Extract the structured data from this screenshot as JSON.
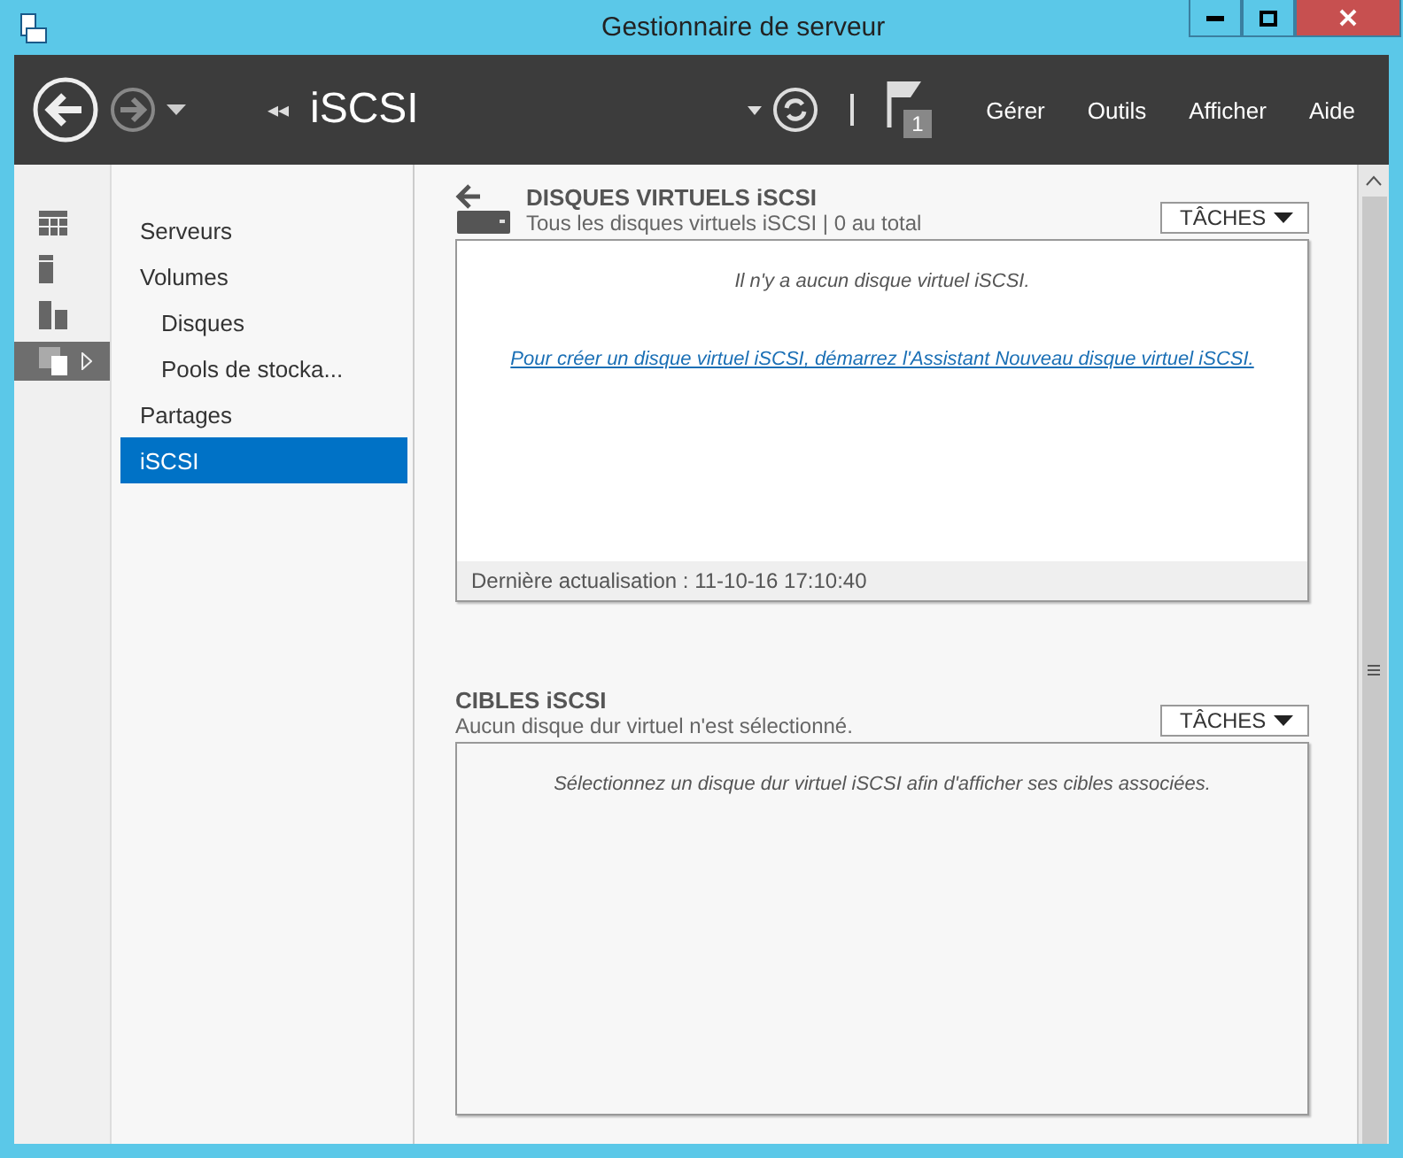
{
  "window": {
    "title": "Gestionnaire de serveur"
  },
  "toolbar": {
    "breadcrumb_arrows": "◂◂",
    "location": "iSCSI",
    "flag_count": "1",
    "menus": [
      "Gérer",
      "Outils",
      "Afficher",
      "Aide"
    ]
  },
  "rail": [
    {
      "kind": "dashboard",
      "selected": false
    },
    {
      "kind": "server",
      "selected": false
    },
    {
      "kind": "servers",
      "selected": false
    },
    {
      "kind": "files",
      "selected": true
    }
  ],
  "nav": [
    {
      "label": "Serveurs",
      "selected": false
    },
    {
      "label": "Volumes",
      "selected": false,
      "children": [
        {
          "label": "Disques",
          "selected": false
        },
        {
          "label": "Pools de stocka...",
          "selected": false
        }
      ]
    },
    {
      "label": "Partages",
      "selected": false
    },
    {
      "label": "iSCSI",
      "selected": true
    }
  ],
  "sections": [
    {
      "title": "DISQUES VIRTUELS iSCSI",
      "subtitle": "Tous les disques virtuels iSCSI | 0 au total",
      "tasks": "TÂCHES",
      "message": "Il n'y a aucun disque virtuel iSCSI.",
      "link": "Pour créer un disque virtuel iSCSI, démarrez l'Assistant Nouveau disque virtuel iSCSI.",
      "footer": "Dernière actualisation : 11-10-16 17:10:40"
    },
    {
      "title": "CIBLES iSCSI",
      "subtitle": "Aucun disque dur virtuel n'est sélectionné.",
      "tasks": "TÂCHES",
      "message": "Sélectionnez un disque dur virtuel iSCSI afin d'afficher ses cibles associées."
    }
  ]
}
